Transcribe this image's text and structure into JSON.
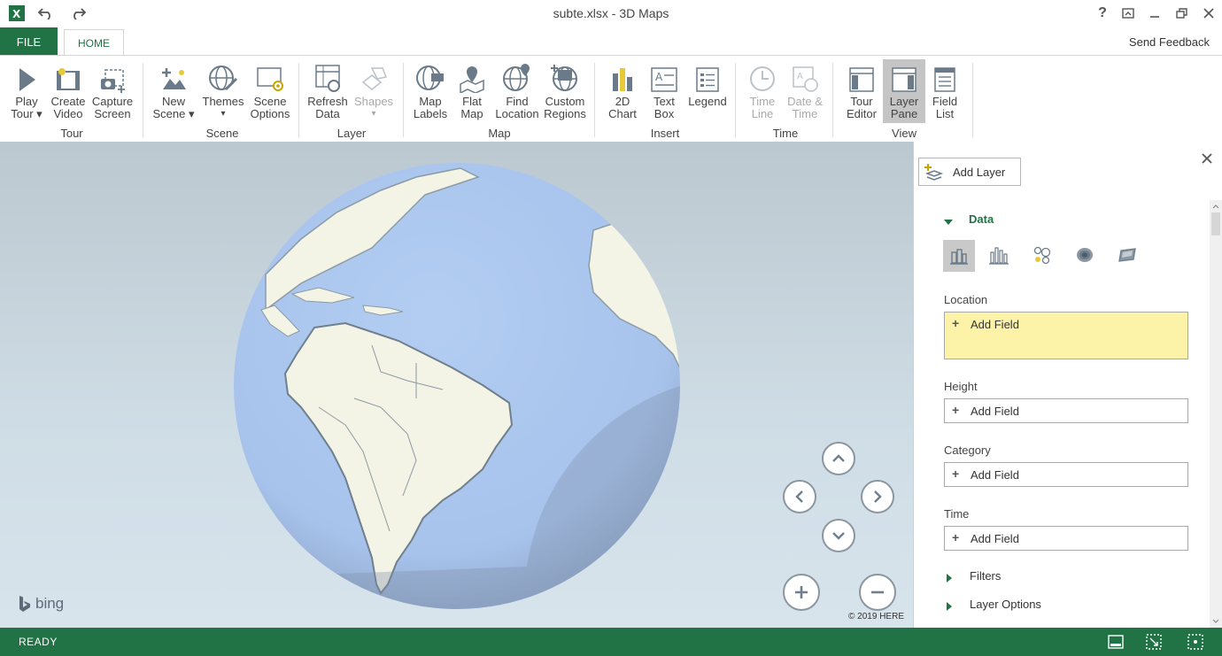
{
  "window": {
    "title": "subte.xlsx - 3D Maps"
  },
  "tabs": {
    "file": "FILE",
    "home": "HOME",
    "feedback": "Send Feedback"
  },
  "ribbon": {
    "tour": {
      "group": "Tour",
      "play": [
        "Play",
        "Tour ▾"
      ],
      "video": [
        "Create",
        "Video"
      ],
      "capture": [
        "Capture",
        "Screen"
      ]
    },
    "scene": {
      "group": "Scene",
      "new": [
        "New",
        "Scene ▾"
      ],
      "themes": [
        "Themes",
        "▾"
      ],
      "options": [
        "Scene",
        "Options"
      ]
    },
    "layer": {
      "group": "Layer",
      "refresh": [
        "Refresh",
        "Data"
      ],
      "shapes": [
        "Shapes",
        "▾"
      ]
    },
    "map": {
      "group": "Map",
      "labels": [
        "Map",
        "Labels"
      ],
      "flat": [
        "Flat",
        "Map"
      ],
      "find": [
        "Find",
        "Location"
      ],
      "regions": [
        "Custom",
        "Regions"
      ]
    },
    "insert": {
      "group": "Insert",
      "chart": [
        "2D",
        "Chart"
      ],
      "textbox": [
        "Text",
        "Box"
      ],
      "legend": [
        "Legend",
        ""
      ]
    },
    "time": {
      "group": "Time",
      "timeline": [
        "Time",
        "Line"
      ],
      "datetime": [
        "Date &",
        "Time"
      ]
    },
    "view": {
      "group": "View",
      "tour_editor": [
        "Tour",
        "Editor"
      ],
      "layer_pane": [
        "Layer",
        "Pane"
      ],
      "field_list": [
        "Field",
        "List"
      ]
    }
  },
  "map": {
    "bing": "bing",
    "copyright": "© 2019 HERE"
  },
  "pane": {
    "add_layer": "Add Layer",
    "data_heading": "Data",
    "location": {
      "label": "Location",
      "add": "Add Field"
    },
    "height": {
      "label": "Height",
      "add": "Add Field"
    },
    "category": {
      "label": "Category",
      "add": "Add Field"
    },
    "time": {
      "label": "Time",
      "add": "Add Field"
    },
    "filters": "Filters",
    "layer_options": "Layer Options"
  },
  "status": {
    "ready": "READY"
  },
  "colors": {
    "accent": "#217346",
    "location_highlight": "#fcf3a8",
    "ocean": "#aac6ee",
    "land": "#f3f3e6"
  }
}
